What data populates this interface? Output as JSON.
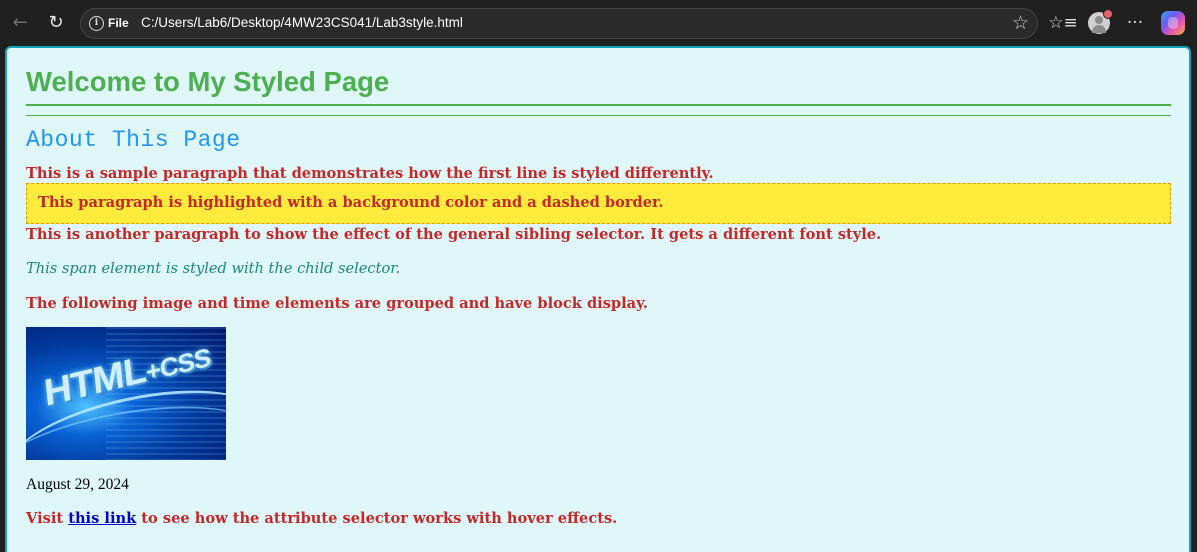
{
  "browser": {
    "address_prefix": "File",
    "url": "C:/Users/Lab6/Desktop/4MW23CS041/Lab3style.html"
  },
  "page": {
    "heading": "Welcome to My Styled Page",
    "subheading": "About This Page",
    "paragraph_first_line": "This is a sample paragraph that demonstrates how the first line is styled differently.",
    "highlighted_paragraph": "This paragraph is highlighted with a background color and a dashed border.",
    "sibling_paragraph": "This is another paragraph to show the effect of the general sibling selector. It gets a different font style.",
    "child_span": "This span element is styled with the child selector.",
    "grouped_paragraph": "The following image and time elements are grouped and have block display.",
    "image_text": "HTML",
    "image_text_suffix": "+CSS",
    "time": "August 29, 2024",
    "link_paragraph": {
      "before": "Visit ",
      "link_text": "this link",
      "after": " to see how the attribute selector works with hover effects."
    }
  },
  "colors": {
    "heading": "#4caf50",
    "subheading": "#2196f3",
    "paragraph": "#c62828",
    "highlight_bg": "#ffeb3b",
    "span": "#1b8a78",
    "page_bg": "#e0f7fa",
    "link": "#0000cc"
  },
  "icons": [
    "back-arrow-icon",
    "reload-icon",
    "info-icon",
    "star-icon",
    "favorites-icon",
    "profile-avatar",
    "more-icon",
    "copilot-icon"
  ]
}
